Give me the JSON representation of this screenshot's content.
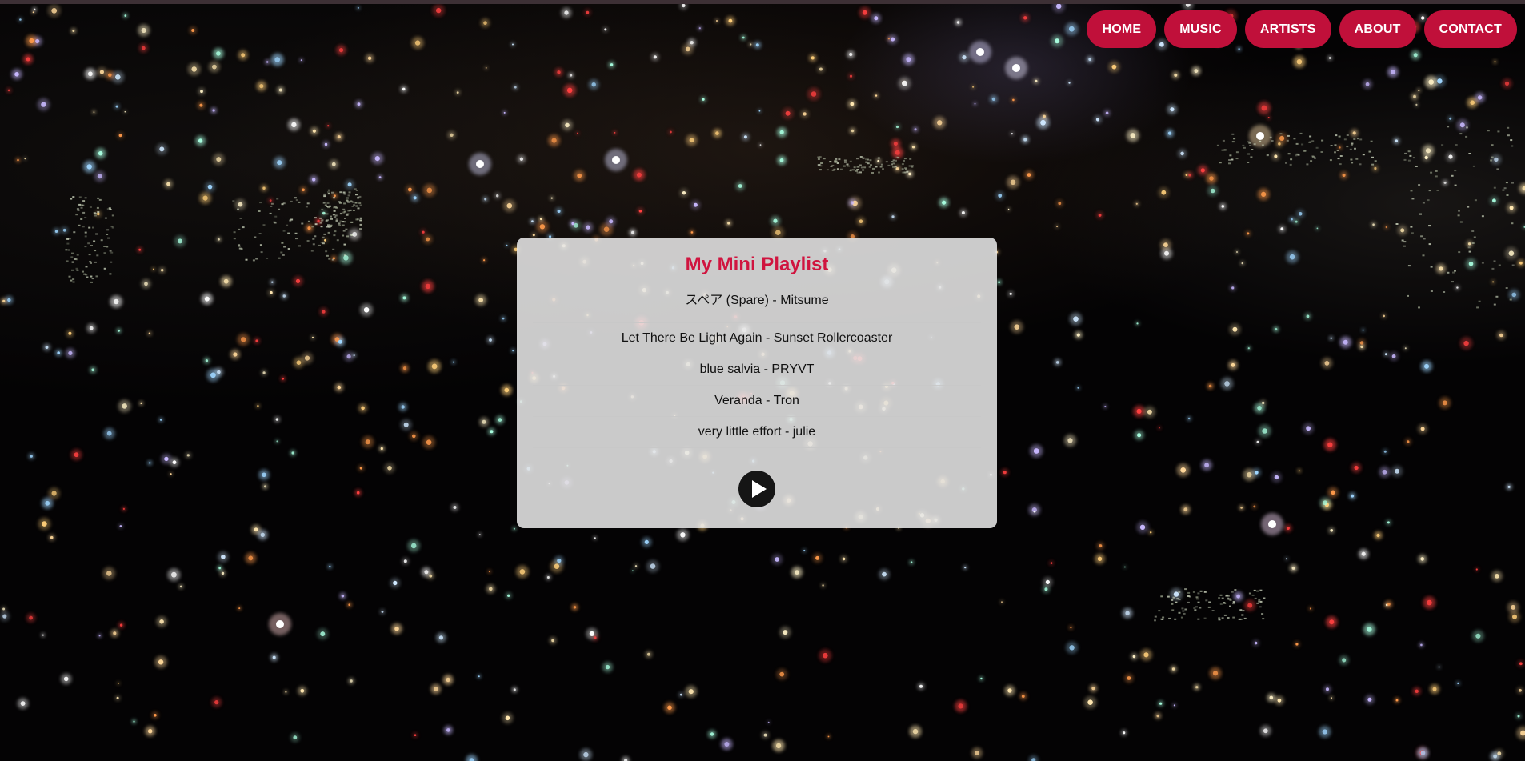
{
  "nav": {
    "items": [
      {
        "label": "HOME"
      },
      {
        "label": "MUSIC"
      },
      {
        "label": "ARTISTS"
      },
      {
        "label": "ABOUT"
      },
      {
        "label": "CONTACT"
      }
    ]
  },
  "playlist": {
    "title": "My Mini Playlist",
    "tracks": [
      {
        "label": "スペア (Spare) - Mitsume"
      },
      {
        "label": "Let There Be Light Again - Sunset Rollercoaster"
      },
      {
        "label": "blue salvia - PRYVT"
      },
      {
        "label": "Veranda - Tron"
      },
      {
        "label": "very little effort - julie"
      }
    ],
    "play_icon": "play-icon"
  },
  "background": {
    "image": "night-city-lights"
  },
  "colors": {
    "accent": "#c0103a",
    "title": "#d0143f",
    "card": "#e6e6e6",
    "play_button": "#151515"
  }
}
